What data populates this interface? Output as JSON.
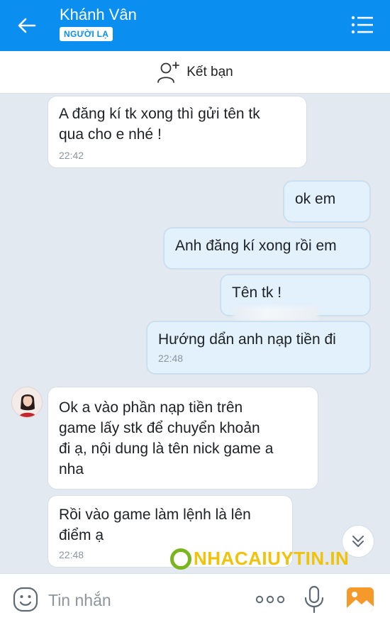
{
  "header": {
    "title": "Khánh Vân",
    "badge": "NGƯỜI LẠ",
    "back_icon": "arrow-left-icon",
    "menu_icon": "list-menu-icon"
  },
  "friend_bar": {
    "icon": "add-friend-icon",
    "label": "Kết bạn"
  },
  "messages": [
    {
      "side": "in",
      "text": "A đăng kí tk xong thì gửi tên tk qua cho e nhé !",
      "line1": "A đăng kí tk xong thì gửi tên tk",
      "line2": "qua cho e nhé !",
      "time": "22:42"
    },
    {
      "side": "out",
      "text": "ok em"
    },
    {
      "side": "out",
      "text": "Anh đăng kí xong rồi em"
    },
    {
      "side": "out",
      "text": "Tên tk !"
    },
    {
      "side": "out",
      "text": "Hướng dẩn anh nạp tiền đi",
      "time": "22:48"
    },
    {
      "side": "in",
      "line1": "Ok a vào phần nạp tiền trên",
      "line2": "game lấy stk để chuyển khoản",
      "line3": "đi ạ, nội dung là tên nick game a",
      "line4": "nha"
    },
    {
      "side": "in",
      "line1": "Rồi vào game làm lệnh là lên",
      "line2": "điểm ạ",
      "time": "22:48"
    }
  ],
  "watermark": "NHACAIUYTIN.IN",
  "input": {
    "placeholder": "Tin nhắn",
    "value": ""
  },
  "colors": {
    "header_blue": "#0a8ef0",
    "outgoing_bubble": "#e3f1fd",
    "incoming_bubble": "#ffffff",
    "chat_background": "#e2e9f1",
    "watermark_yellow": "#f0c20a",
    "watermark_green": "#7ab51d"
  }
}
